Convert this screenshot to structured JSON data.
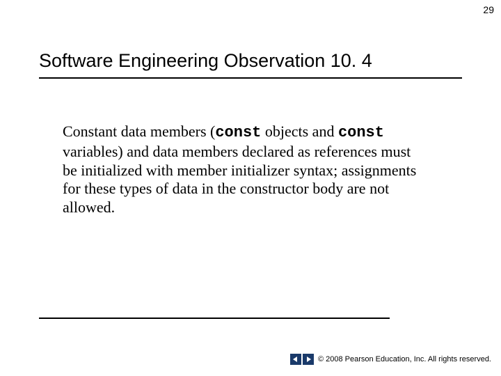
{
  "page_number": "29",
  "title": "Software Engineering Observation 10. 4",
  "body": {
    "seg1": "Constant data members (",
    "code1": "const",
    "seg2": " objects and ",
    "code2": "const",
    "seg3": " variables) and data members declared as references must be initialized with member initializer syntax; assignments for these types of data in the constructor body are not allowed."
  },
  "footer": {
    "copyright": "© 2008 Pearson Education, Inc.  All rights reserved."
  }
}
